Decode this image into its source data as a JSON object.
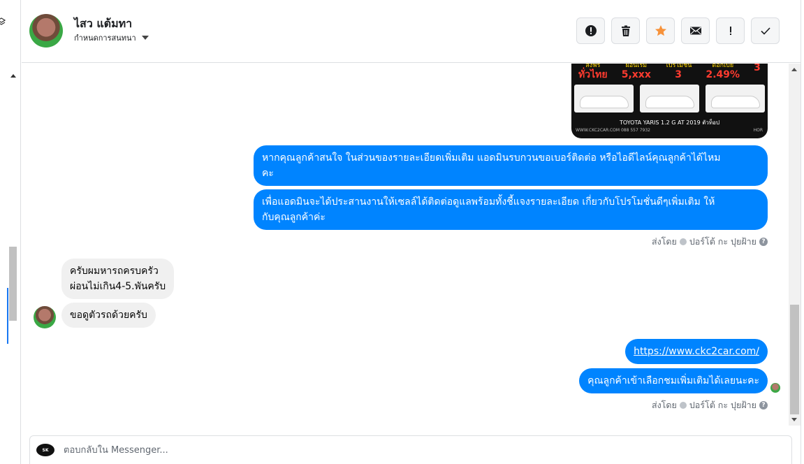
{
  "header": {
    "contact_name": "ไสว แต้มทา",
    "convo_setting": "กำหนดการสนทนา"
  },
  "actions": [
    {
      "name": "spam",
      "icon": "alert-circle-icon"
    },
    {
      "name": "delete",
      "icon": "trash-icon"
    },
    {
      "name": "star",
      "icon": "star-icon"
    },
    {
      "name": "mark-unread",
      "icon": "envelope-icon"
    },
    {
      "name": "important",
      "icon": "exclamation-icon"
    },
    {
      "name": "done",
      "icon": "checkmark-icon"
    }
  ],
  "colors": {
    "outgoing_bubble": "#0084ff",
    "incoming_bubble": "#f0f0f0",
    "star": "#f7923a"
  },
  "attachment": {
    "stats": [
      {
        "label": "ส่งฟรี",
        "value": "ทั่วไทย"
      },
      {
        "label": "ผ่อนเริ่ม",
        "value": "5,xxx"
      },
      {
        "label": "โปรโมชั่น",
        "value": "3"
      },
      {
        "label": "ดอกเบี้ย",
        "value": "2.49%"
      },
      {
        "label": "",
        "value": "3"
      }
    ],
    "caption": "TOYOTA YARIS 1.2 G AT 2019 ตัวท็อป",
    "footer_left": "WWW.CKC2CAR.COM  088 557 7932",
    "footer_right": "HOR"
  },
  "messages": [
    {
      "id": "m1",
      "dir": "out",
      "text_lines": [
        "หากคุณลูกค้าสนใจ ในส่วนของรายละเอียดเพิ่มเติม แอดมินรบกวนขอเบอร์ติดต่อ หรือไอดีไลน์คุณลูกค้าได้ไหม",
        "คะ"
      ]
    },
    {
      "id": "m2",
      "dir": "out",
      "text_lines": [
        "เพื่อแอดมินจะได้ประสานงานให้เซลล์ได้ติดต่อดูแลพร้อมทั้งชี้แจงรายละเอียด เกี่ยวกับโปรโมชั่นดีๆเพิ่มเติม ให้",
        "กับคุณลูกค้าค่ะ"
      ]
    },
    {
      "id": "m3",
      "dir": "in",
      "text_lines": [
        "ครับผมหารถครบครัว",
        "ผ่อนไม่เกิน4-5.พันครับ"
      ]
    },
    {
      "id": "m4",
      "dir": "in",
      "text_lines": [
        "ขอดูตัวรถด้วยครับ"
      ]
    },
    {
      "id": "m5",
      "dir": "out",
      "text_lines": [
        "https://www.ckc2car.com/"
      ]
    },
    {
      "id": "m6",
      "dir": "out",
      "text_lines": [
        "คุณลูกค้าเข้าเลือกชมเพิ่มเติมได้เลยนะคะ"
      ]
    }
  ],
  "sent_by": {
    "prefix": "ส่งโดย",
    "name": "ปอร์โต้ กะ ปุยฝ้าย",
    "help": "?"
  },
  "composer": {
    "placeholder": "ตอบกลับใน Messenger...",
    "page_logo_text": "SK"
  }
}
